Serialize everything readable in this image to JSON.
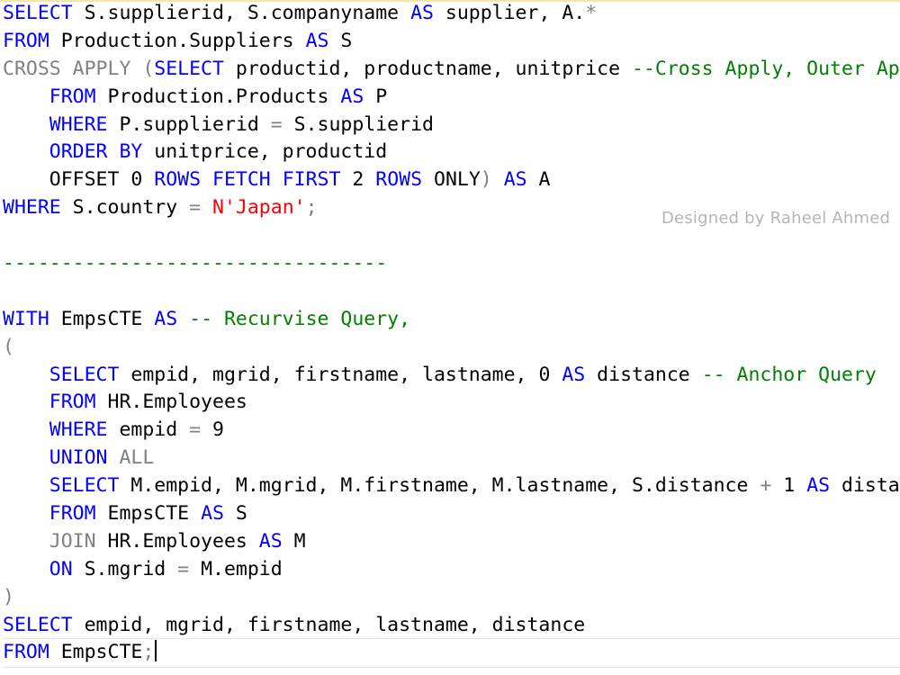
{
  "editor": {
    "lines": [
      [
        {
          "t": "SELECT",
          "c": "kw"
        },
        {
          "t": " S.supplierid, S.companyname ",
          "c": ""
        },
        {
          "t": "AS",
          "c": "kw"
        },
        {
          "t": " supplier, A.",
          "c": ""
        },
        {
          "t": "*",
          "c": "gray"
        }
      ],
      [
        {
          "t": "FROM",
          "c": "kw"
        },
        {
          "t": " Production.Suppliers ",
          "c": ""
        },
        {
          "t": "AS",
          "c": "kw"
        },
        {
          "t": " S",
          "c": ""
        }
      ],
      [
        {
          "t": "CROSS APPLY",
          "c": "gray"
        },
        {
          "t": " (",
          "c": "gray"
        },
        {
          "t": "SELECT",
          "c": "kw"
        },
        {
          "t": " productid, productname, unitprice ",
          "c": ""
        },
        {
          "t": "--Cross Apply, Outer Apply",
          "c": "cm"
        }
      ],
      [
        {
          "t": "    ",
          "c": ""
        },
        {
          "t": "FROM",
          "c": "kw"
        },
        {
          "t": " Production.Products ",
          "c": ""
        },
        {
          "t": "AS",
          "c": "kw"
        },
        {
          "t": " P",
          "c": ""
        }
      ],
      [
        {
          "t": "    ",
          "c": ""
        },
        {
          "t": "WHERE",
          "c": "kw"
        },
        {
          "t": " P.supplierid ",
          "c": ""
        },
        {
          "t": "=",
          "c": "gray"
        },
        {
          "t": " S.supplierid",
          "c": ""
        }
      ],
      [
        {
          "t": "    ",
          "c": ""
        },
        {
          "t": "ORDER BY",
          "c": "kw"
        },
        {
          "t": " unitprice, productid",
          "c": ""
        }
      ],
      [
        {
          "t": "    OFFSET 0 ",
          "c": ""
        },
        {
          "t": "ROWS",
          "c": "kw"
        },
        {
          "t": " ",
          "c": ""
        },
        {
          "t": "FETCH",
          "c": "kw"
        },
        {
          "t": " ",
          "c": ""
        },
        {
          "t": "FIRST",
          "c": "kw"
        },
        {
          "t": " 2 ",
          "c": ""
        },
        {
          "t": "ROWS",
          "c": "kw"
        },
        {
          "t": " ONLY",
          "c": ""
        },
        {
          "t": ")",
          "c": "gray"
        },
        {
          "t": " ",
          "c": ""
        },
        {
          "t": "AS",
          "c": "kw"
        },
        {
          "t": " A",
          "c": ""
        }
      ],
      [
        {
          "t": "WHERE",
          "c": "kw"
        },
        {
          "t": " S.country ",
          "c": ""
        },
        {
          "t": "=",
          "c": "gray"
        },
        {
          "t": " ",
          "c": ""
        },
        {
          "t": "N'Japan'",
          "c": "str"
        },
        {
          "t": ";",
          "c": "gray"
        }
      ],
      [],
      [
        {
          "t": "---------------------------------",
          "c": "cm"
        }
      ],
      [],
      [
        {
          "t": "WITH",
          "c": "kw"
        },
        {
          "t": " EmpsCTE ",
          "c": ""
        },
        {
          "t": "AS",
          "c": "kw"
        },
        {
          "t": " ",
          "c": ""
        },
        {
          "t": "-- Recurvise Query,",
          "c": "cm"
        }
      ],
      [
        {
          "t": "(",
          "c": "gray"
        }
      ],
      [
        {
          "t": "    ",
          "c": ""
        },
        {
          "t": "SELECT",
          "c": "kw"
        },
        {
          "t": " empid, mgrid, firstname, lastname, 0 ",
          "c": ""
        },
        {
          "t": "AS",
          "c": "kw"
        },
        {
          "t": " distance ",
          "c": ""
        },
        {
          "t": "-- Anchor Query",
          "c": "cm"
        }
      ],
      [
        {
          "t": "    ",
          "c": ""
        },
        {
          "t": "FROM",
          "c": "kw"
        },
        {
          "t": " HR.Employees",
          "c": ""
        }
      ],
      [
        {
          "t": "    ",
          "c": ""
        },
        {
          "t": "WHERE",
          "c": "kw"
        },
        {
          "t": " empid ",
          "c": ""
        },
        {
          "t": "=",
          "c": "gray"
        },
        {
          "t": " 9",
          "c": ""
        }
      ],
      [
        {
          "t": "    ",
          "c": ""
        },
        {
          "t": "UNION",
          "c": "kw"
        },
        {
          "t": " ",
          "c": ""
        },
        {
          "t": "ALL",
          "c": "gray"
        }
      ],
      [
        {
          "t": "    ",
          "c": ""
        },
        {
          "t": "SELECT",
          "c": "kw"
        },
        {
          "t": " M.empid, M.mgrid, M.firstname, M.lastname, S.distance ",
          "c": ""
        },
        {
          "t": "+",
          "c": "gray"
        },
        {
          "t": " 1 ",
          "c": ""
        },
        {
          "t": "AS",
          "c": "kw"
        },
        {
          "t": " distance",
          "c": ""
        }
      ],
      [
        {
          "t": "    ",
          "c": ""
        },
        {
          "t": "FROM",
          "c": "kw"
        },
        {
          "t": " EmpsCTE ",
          "c": ""
        },
        {
          "t": "AS",
          "c": "kw"
        },
        {
          "t": " S",
          "c": ""
        }
      ],
      [
        {
          "t": "    ",
          "c": ""
        },
        {
          "t": "JOIN",
          "c": "gray"
        },
        {
          "t": " HR.Employees ",
          "c": ""
        },
        {
          "t": "AS",
          "c": "kw"
        },
        {
          "t": " M",
          "c": ""
        }
      ],
      [
        {
          "t": "    ",
          "c": ""
        },
        {
          "t": "ON",
          "c": "kw"
        },
        {
          "t": " S.mgrid ",
          "c": ""
        },
        {
          "t": "=",
          "c": "gray"
        },
        {
          "t": " M.empid",
          "c": ""
        }
      ],
      [
        {
          "t": ")",
          "c": "gray"
        }
      ],
      [
        {
          "t": "SELECT",
          "c": "kw"
        },
        {
          "t": " empid, mgrid, firstname, lastname, distance",
          "c": ""
        }
      ],
      [
        {
          "t": "FROM",
          "c": "kw"
        },
        {
          "t": " EmpsCTE",
          "c": ""
        },
        {
          "t": ";",
          "c": "gray"
        }
      ]
    ],
    "cursor_line": 23
  },
  "watermark": "Designed by Raheel Ahmed",
  "colors": {
    "keyword": "#0000ff",
    "operator": "#808080",
    "string": "#ff0000",
    "comment": "#008000",
    "text": "#000000"
  }
}
